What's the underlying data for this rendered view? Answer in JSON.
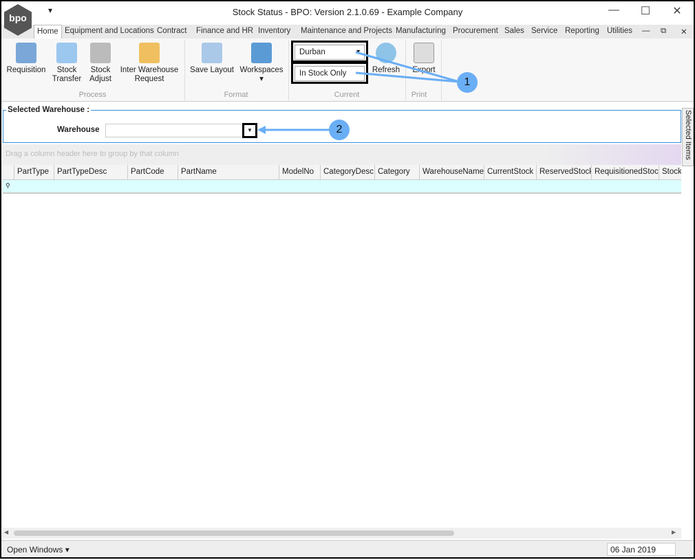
{
  "window": {
    "title": "Stock Status - BPO: Version 2.1.0.69 - Example Company",
    "logo_text": "bpo",
    "qat": "▾",
    "minimize": "—",
    "maximize": "☐",
    "close": "✕"
  },
  "tabs": [
    "Home",
    "Equipment and Locations",
    "Contract",
    "Finance and HR",
    "Inventory",
    "Maintenance and Projects",
    "Manufacturing",
    "Procurement",
    "Sales",
    "Service",
    "Reporting",
    "Utilities"
  ],
  "mdi_controls": [
    "—",
    "⧉",
    "✕"
  ],
  "ribbon": {
    "process": {
      "label": "Process",
      "buttons": [
        "Requisition",
        "Stock Transfer",
        "Stock Adjust",
        "Inter Warehouse Request"
      ]
    },
    "format": {
      "label": "Format",
      "buttons": [
        "Save Layout",
        "Workspaces"
      ]
    },
    "current": {
      "label": "Current",
      "warehouse_value": "Durban",
      "filter_value": "In Stock Only",
      "refresh": "Refresh"
    },
    "print": {
      "label": "Print",
      "export": "Export"
    }
  },
  "annotations": [
    "1",
    "2"
  ],
  "selected_warehouse": {
    "title": "Selected Warehouse :",
    "label": "Warehouse",
    "value": ""
  },
  "grid": {
    "group_hint": "Drag a column header here to group by that column",
    "columns": [
      "PartType",
      "PartTypeDesc",
      "PartCode",
      "PartName",
      "ModelNo",
      "CategoryDesc",
      "Category",
      "WarehouseName",
      "CurrentStock",
      "ReservedStock",
      "RequisitionedStock",
      "StockO"
    ]
  },
  "side_panel": "Selected Items",
  "status": {
    "open_windows": "Open Windows ▾",
    "date": "06 Jan 2019"
  }
}
